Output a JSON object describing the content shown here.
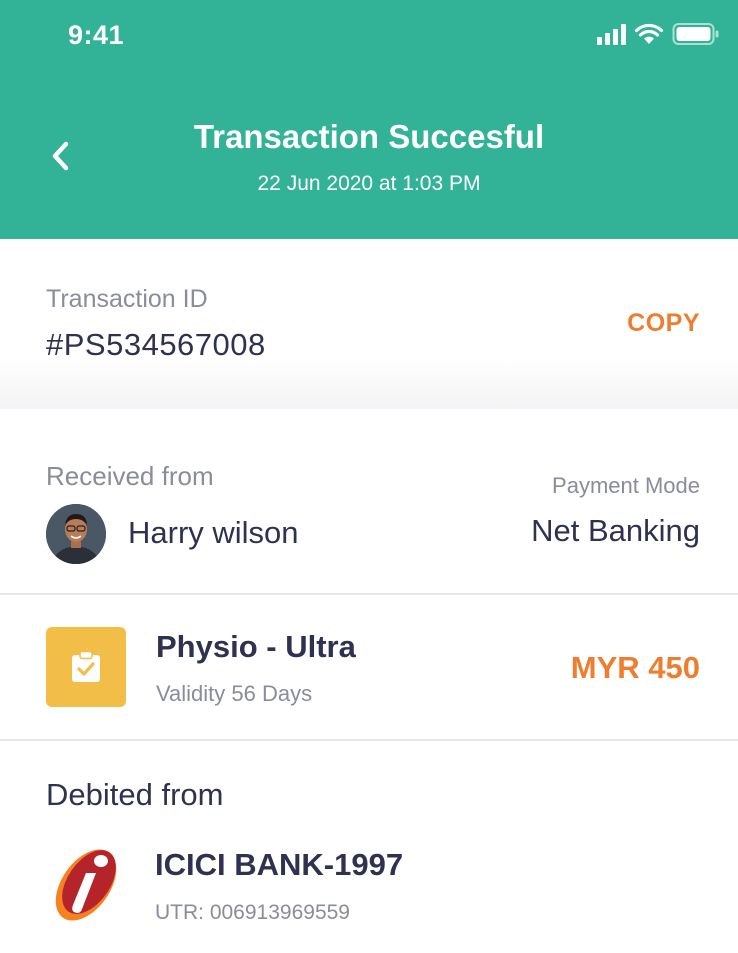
{
  "status_bar": {
    "time": "9:41",
    "icons": [
      "signal-icon",
      "wifi-icon",
      "battery-icon"
    ]
  },
  "header": {
    "back_icon": "chevron-left-icon",
    "title": "Transaction Succesful",
    "subtitle": "22 Jun 2020 at 1:03 PM",
    "background_color": "#32b296"
  },
  "transaction": {
    "label": "Transaction ID",
    "value": "#PS534567008",
    "copy_label": "COPY"
  },
  "received": {
    "label": "Received from",
    "sender_name": "Harry wilson",
    "payment_mode_label": "Payment Mode",
    "payment_mode_value": "Net Banking"
  },
  "plan": {
    "icon": "clipboard-check-icon",
    "name": "Physio - Ultra",
    "validity": "Validity 56 Days",
    "price": "MYR 450"
  },
  "debited": {
    "label": "Debited from",
    "bank_icon": "icici-logo-icon",
    "bank_name": "ICICI BANK-1997",
    "utr": "UTR: 006913969559"
  },
  "colors": {
    "accent": "#ef7d2f",
    "primary_text": "#2f3150",
    "secondary_text": "#8a8c9c",
    "plan_icon_bg": "#f2be48"
  }
}
